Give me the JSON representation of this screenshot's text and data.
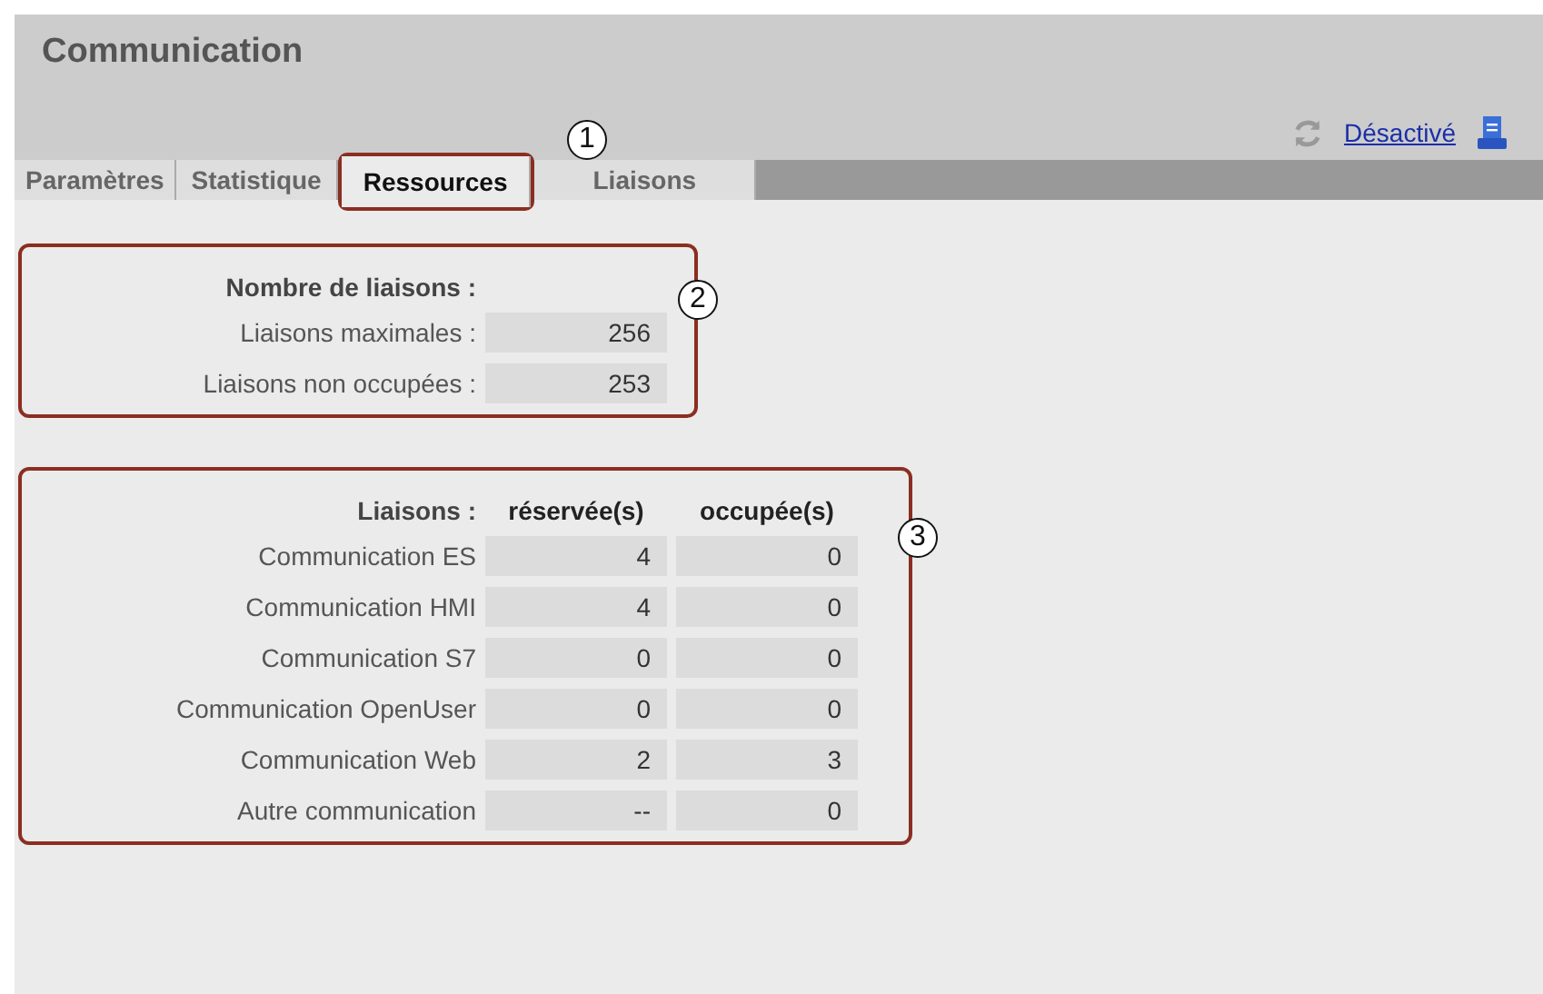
{
  "header": {
    "title": "Communication",
    "status_link": "Désactivé"
  },
  "tabs": [
    {
      "label": "Paramètres",
      "selected": false
    },
    {
      "label": "Statistique",
      "selected": false
    },
    {
      "label": "Ressources",
      "selected": true
    },
    {
      "label": "Liaisons",
      "selected": false
    }
  ],
  "callouts": [
    "1",
    "2",
    "3"
  ],
  "summary": {
    "heading": "Nombre de liaisons :",
    "rows": [
      {
        "label": "Liaisons maximales :",
        "value": "256"
      },
      {
        "label": "Liaisons non occupées :",
        "value": "253"
      }
    ]
  },
  "connections": {
    "columns": [
      "Liaisons :",
      "réservée(s)",
      "occupée(s)"
    ],
    "rows": [
      {
        "label": "Communication ES",
        "reserved": "4",
        "occupied": "0"
      },
      {
        "label": "Communication HMI",
        "reserved": "4",
        "occupied": "0"
      },
      {
        "label": "Communication S7",
        "reserved": "0",
        "occupied": "0"
      },
      {
        "label": "Communication OpenUser",
        "reserved": "0",
        "occupied": "0"
      },
      {
        "label": "Communication Web",
        "reserved": "2",
        "occupied": "3"
      },
      {
        "label": "Autre communication",
        "reserved": "--",
        "occupied": "0"
      }
    ]
  }
}
